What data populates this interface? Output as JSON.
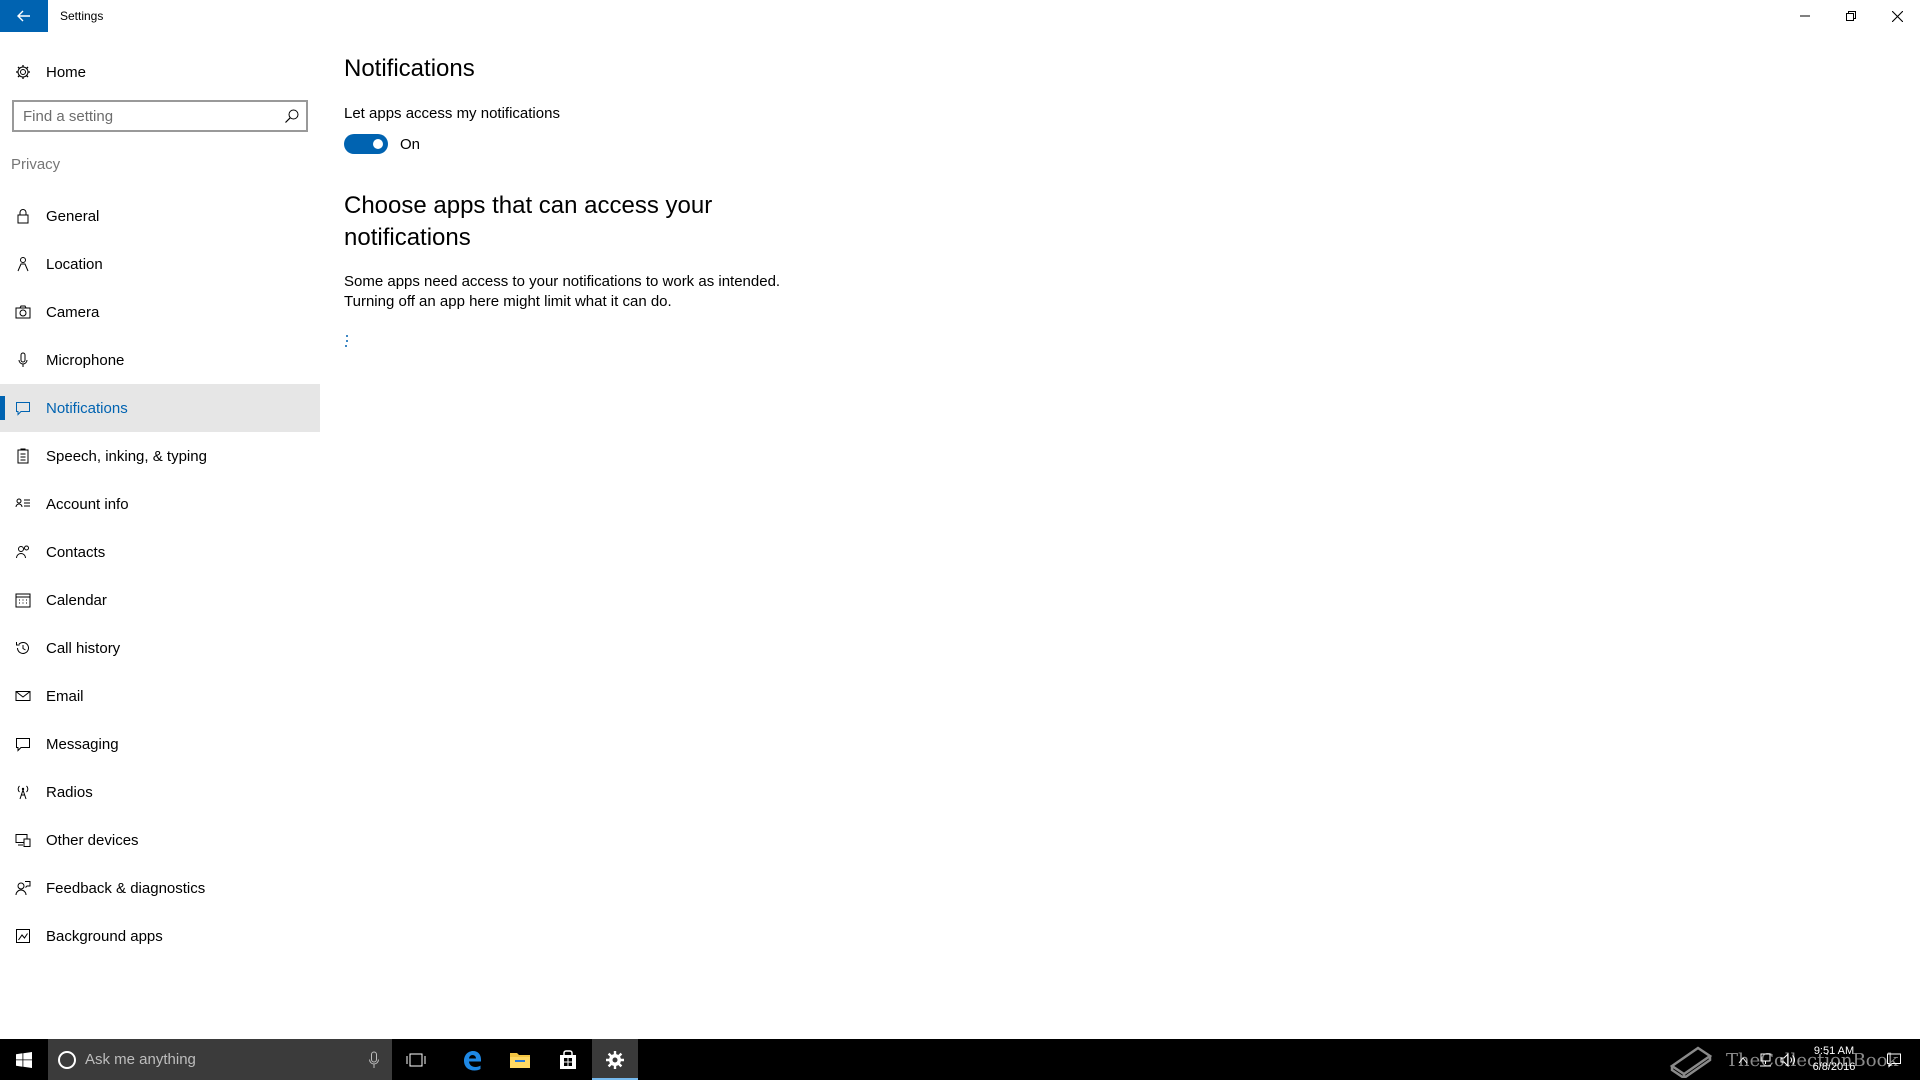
{
  "window": {
    "title": "Settings",
    "accent": "#0063b1"
  },
  "sidebar": {
    "home_label": "Home",
    "search_placeholder": "Find a setting",
    "section": "Privacy",
    "items": [
      {
        "label": "General",
        "icon": "lock-icon",
        "selected": false
      },
      {
        "label": "Location",
        "icon": "location-person-icon",
        "selected": false
      },
      {
        "label": "Camera",
        "icon": "camera-icon",
        "selected": false
      },
      {
        "label": "Microphone",
        "icon": "microphone-icon",
        "selected": false
      },
      {
        "label": "Notifications",
        "icon": "speech-bubble-icon",
        "selected": true
      },
      {
        "label": "Speech, inking, & typing",
        "icon": "clipboard-icon",
        "selected": false
      },
      {
        "label": "Account info",
        "icon": "contact-card-icon",
        "selected": false
      },
      {
        "label": "Contacts",
        "icon": "people-icon",
        "selected": false
      },
      {
        "label": "Calendar",
        "icon": "calendar-icon",
        "selected": false
      },
      {
        "label": "Call history",
        "icon": "history-icon",
        "selected": false
      },
      {
        "label": "Email",
        "icon": "envelope-icon",
        "selected": false
      },
      {
        "label": "Messaging",
        "icon": "chat-icon",
        "selected": false
      },
      {
        "label": "Radios",
        "icon": "antenna-icon",
        "selected": false
      },
      {
        "label": "Other devices",
        "icon": "devices-icon",
        "selected": false
      },
      {
        "label": "Feedback & diagnostics",
        "icon": "feedback-icon",
        "selected": false
      },
      {
        "label": "Background apps",
        "icon": "background-apps-icon",
        "selected": false
      }
    ]
  },
  "main": {
    "title": "Notifications",
    "toggle_label": "Let apps access my notifications",
    "toggle_state": "On",
    "section_heading": "Choose apps that can access your notifications",
    "description_line1": "Some apps need access to your notifications to work as intended.",
    "description_line2": "Turning off an app here might limit what it can do."
  },
  "taskbar": {
    "search_placeholder": "Ask me anything",
    "watermark": "TheCollectionBook",
    "time": "9:51 AM",
    "date": "6/8/2016"
  }
}
